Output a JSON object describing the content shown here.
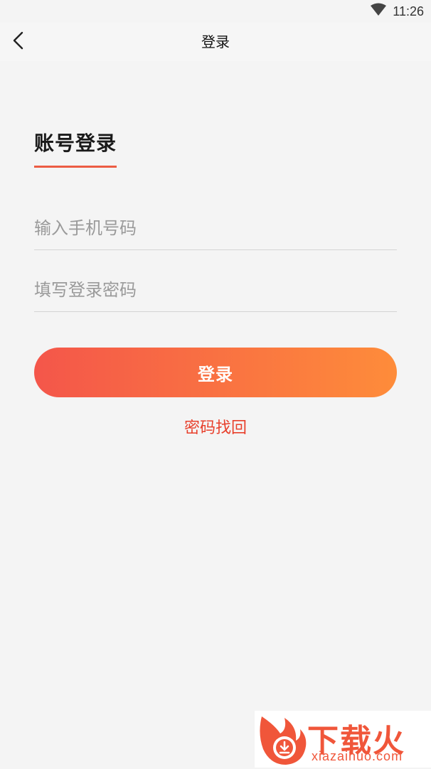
{
  "status_bar": {
    "time": "11:26",
    "wifi_icon": "wifi-icon"
  },
  "nav": {
    "back_icon": "chevron-left-icon",
    "title": "登录"
  },
  "form": {
    "section_title": "账号登录",
    "phone_placeholder": "输入手机号码",
    "phone_value": "",
    "password_placeholder": "填写登录密码",
    "password_value": "",
    "login_label": "登录",
    "recover_label": "密码找回"
  },
  "watermark": {
    "brand_cn": "下载火",
    "brand_en": "xiazaihuo.com",
    "logo_icon": "flame-download-logo"
  },
  "colors": {
    "accent": "#ec5c43",
    "gradient_start": "#f4564a",
    "gradient_end": "#fe8c3a",
    "link": "#e8402c"
  }
}
